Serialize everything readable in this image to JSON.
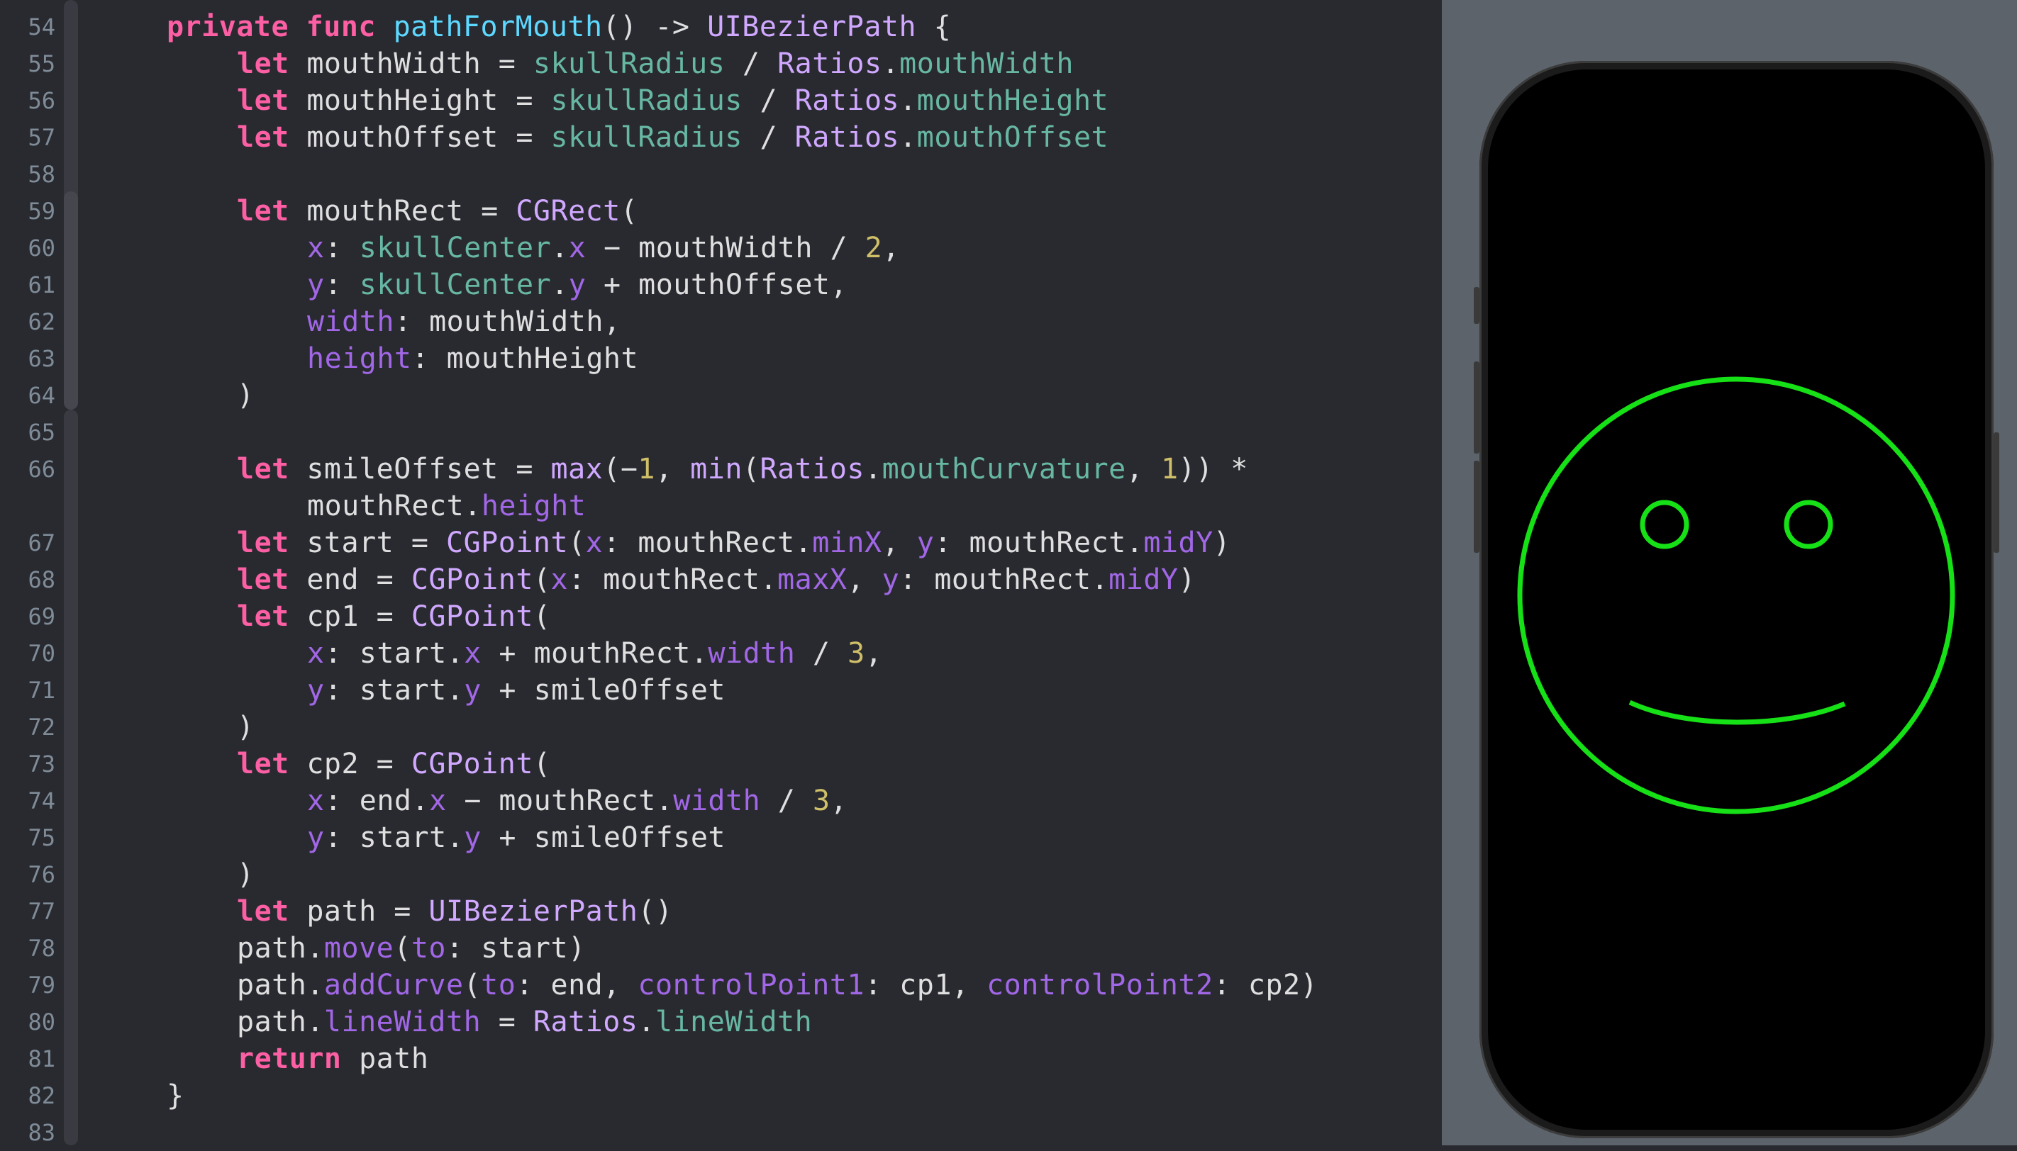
{
  "editor": {
    "lines": [
      {
        "n": "54",
        "indent": 1,
        "tokens": [
          [
            "kw",
            "private"
          ],
          [
            "tx",
            " "
          ],
          [
            "kw",
            "func"
          ],
          [
            "tx",
            " "
          ],
          [
            "cl",
            "pathForMouth"
          ],
          [
            "tx",
            "() -> "
          ],
          [
            "ty",
            "UIBezierPath"
          ],
          [
            "tx",
            " {"
          ]
        ]
      },
      {
        "n": "55",
        "indent": 2,
        "tokens": [
          [
            "kw",
            "let"
          ],
          [
            "tx",
            " mouthWidth = "
          ],
          [
            "fn",
            "skullRadius"
          ],
          [
            "tx",
            " / "
          ],
          [
            "ty",
            "Ratios"
          ],
          [
            "tx",
            "."
          ],
          [
            "fn",
            "mouthWidth"
          ]
        ]
      },
      {
        "n": "56",
        "indent": 2,
        "tokens": [
          [
            "kw",
            "let"
          ],
          [
            "tx",
            " mouthHeight = "
          ],
          [
            "fn",
            "skullRadius"
          ],
          [
            "tx",
            " / "
          ],
          [
            "ty",
            "Ratios"
          ],
          [
            "tx",
            "."
          ],
          [
            "fn",
            "mouthHeight"
          ]
        ]
      },
      {
        "n": "57",
        "indent": 2,
        "tokens": [
          [
            "kw",
            "let"
          ],
          [
            "tx",
            " mouthOffset = "
          ],
          [
            "fn",
            "skullRadius"
          ],
          [
            "tx",
            " / "
          ],
          [
            "ty",
            "Ratios"
          ],
          [
            "tx",
            "."
          ],
          [
            "fn",
            "mouthOffset"
          ]
        ]
      },
      {
        "n": "58",
        "indent": 0,
        "tokens": []
      },
      {
        "n": "59",
        "indent": 2,
        "tokens": [
          [
            "kw",
            "let"
          ],
          [
            "tx",
            " mouthRect = "
          ],
          [
            "ty",
            "CGRect"
          ],
          [
            "tx",
            "("
          ]
        ]
      },
      {
        "n": "60",
        "indent": 3,
        "tokens": [
          [
            "pr",
            "x"
          ],
          [
            "tx",
            ": "
          ],
          [
            "fn",
            "skullCenter"
          ],
          [
            "tx",
            "."
          ],
          [
            "pr",
            "x"
          ],
          [
            "tx",
            " − mouthWidth / "
          ],
          [
            "num",
            "2"
          ],
          [
            "tx",
            ","
          ]
        ]
      },
      {
        "n": "61",
        "indent": 3,
        "tokens": [
          [
            "pr",
            "y"
          ],
          [
            "tx",
            ": "
          ],
          [
            "fn",
            "skullCenter"
          ],
          [
            "tx",
            "."
          ],
          [
            "pr",
            "y"
          ],
          [
            "tx",
            " + mouthOffset,"
          ]
        ]
      },
      {
        "n": "62",
        "indent": 3,
        "tokens": [
          [
            "pr",
            "width"
          ],
          [
            "tx",
            ": mouthWidth,"
          ]
        ]
      },
      {
        "n": "63",
        "indent": 3,
        "tokens": [
          [
            "pr",
            "height"
          ],
          [
            "tx",
            ": mouthHeight"
          ]
        ]
      },
      {
        "n": "64",
        "indent": 2,
        "tokens": [
          [
            "tx",
            ")"
          ]
        ]
      },
      {
        "n": "65",
        "indent": 0,
        "tokens": []
      },
      {
        "n": "66",
        "indent": 2,
        "tokens": [
          [
            "kw",
            "let"
          ],
          [
            "tx",
            " smileOffset = "
          ],
          [
            "ty",
            "max"
          ],
          [
            "tx",
            "(−"
          ],
          [
            "num",
            "1"
          ],
          [
            "tx",
            ", "
          ],
          [
            "ty",
            "min"
          ],
          [
            "tx",
            "("
          ],
          [
            "ty",
            "Ratios"
          ],
          [
            "tx",
            "."
          ],
          [
            "fn",
            "mouthCurvature"
          ],
          [
            "tx",
            ", "
          ],
          [
            "num",
            "1"
          ],
          [
            "tx",
            "))"
          ],
          [
            "tx",
            " *"
          ]
        ]
      },
      {
        "n": "",
        "indent": 3,
        "tokens": [
          [
            "tx",
            "mouthRect."
          ],
          [
            "pr",
            "height"
          ]
        ]
      },
      {
        "n": "67",
        "indent": 2,
        "tokens": [
          [
            "kw",
            "let"
          ],
          [
            "tx",
            " start = "
          ],
          [
            "ty",
            "CGPoint"
          ],
          [
            "tx",
            "("
          ],
          [
            "pr",
            "x"
          ],
          [
            "tx",
            ": mouthRect."
          ],
          [
            "pr",
            "minX"
          ],
          [
            "tx",
            ", "
          ],
          [
            "pr",
            "y"
          ],
          [
            "tx",
            ": mouthRect."
          ],
          [
            "pr",
            "midY"
          ],
          [
            "tx",
            ")"
          ]
        ]
      },
      {
        "n": "68",
        "indent": 2,
        "tokens": [
          [
            "kw",
            "let"
          ],
          [
            "tx",
            " end = "
          ],
          [
            "ty",
            "CGPoint"
          ],
          [
            "tx",
            "("
          ],
          [
            "pr",
            "x"
          ],
          [
            "tx",
            ": mouthRect."
          ],
          [
            "pr",
            "maxX"
          ],
          [
            "tx",
            ", "
          ],
          [
            "pr",
            "y"
          ],
          [
            "tx",
            ": mouthRect."
          ],
          [
            "pr",
            "midY"
          ],
          [
            "tx",
            ")"
          ]
        ]
      },
      {
        "n": "69",
        "indent": 2,
        "tokens": [
          [
            "kw",
            "let"
          ],
          [
            "tx",
            " cp1 = "
          ],
          [
            "ty",
            "CGPoint"
          ],
          [
            "tx",
            "("
          ]
        ]
      },
      {
        "n": "70",
        "indent": 3,
        "tokens": [
          [
            "pr",
            "x"
          ],
          [
            "tx",
            ": start."
          ],
          [
            "pr",
            "x"
          ],
          [
            "tx",
            " + mouthRect."
          ],
          [
            "pr",
            "width"
          ],
          [
            "tx",
            " / "
          ],
          [
            "num",
            "3"
          ],
          [
            "tx",
            ","
          ]
        ]
      },
      {
        "n": "71",
        "indent": 3,
        "tokens": [
          [
            "pr",
            "y"
          ],
          [
            "tx",
            ": start."
          ],
          [
            "pr",
            "y"
          ],
          [
            "tx",
            " + smileOffset"
          ]
        ]
      },
      {
        "n": "72",
        "indent": 2,
        "tokens": [
          [
            "tx",
            ")"
          ]
        ]
      },
      {
        "n": "73",
        "indent": 2,
        "tokens": [
          [
            "kw",
            "let"
          ],
          [
            "tx",
            " cp2 = "
          ],
          [
            "ty",
            "CGPoint"
          ],
          [
            "tx",
            "("
          ]
        ]
      },
      {
        "n": "74",
        "indent": 3,
        "tokens": [
          [
            "pr",
            "x"
          ],
          [
            "tx",
            ": end."
          ],
          [
            "pr",
            "x"
          ],
          [
            "tx",
            " − mouthRect."
          ],
          [
            "pr",
            "width"
          ],
          [
            "tx",
            " / "
          ],
          [
            "num",
            "3"
          ],
          [
            "tx",
            ","
          ]
        ]
      },
      {
        "n": "75",
        "indent": 3,
        "tokens": [
          [
            "pr",
            "y"
          ],
          [
            "tx",
            ": start."
          ],
          [
            "pr",
            "y"
          ],
          [
            "tx",
            " + smileOffset"
          ]
        ]
      },
      {
        "n": "76",
        "indent": 2,
        "tokens": [
          [
            "tx",
            ")"
          ]
        ]
      },
      {
        "n": "77",
        "indent": 2,
        "tokens": [
          [
            "kw",
            "let"
          ],
          [
            "tx",
            " path = "
          ],
          [
            "ty",
            "UIBezierPath"
          ],
          [
            "tx",
            "()"
          ]
        ]
      },
      {
        "n": "78",
        "indent": 2,
        "tokens": [
          [
            "tx",
            "path."
          ],
          [
            "pr",
            "move"
          ],
          [
            "tx",
            "("
          ],
          [
            "pr",
            "to"
          ],
          [
            "tx",
            ": start)"
          ]
        ]
      },
      {
        "n": "79",
        "indent": 2,
        "tokens": [
          [
            "tx",
            "path."
          ],
          [
            "pr",
            "addCurve"
          ],
          [
            "tx",
            "("
          ],
          [
            "pr",
            "to"
          ],
          [
            "tx",
            ": end, "
          ],
          [
            "pr",
            "controlPoint1"
          ],
          [
            "tx",
            ": cp1, "
          ],
          [
            "pr",
            "controlPoint2"
          ],
          [
            "tx",
            ": cp2)"
          ]
        ]
      },
      {
        "n": "80",
        "indent": 2,
        "tokens": [
          [
            "tx",
            "path."
          ],
          [
            "pr",
            "lineWidth"
          ],
          [
            "tx",
            " = "
          ],
          [
            "ty",
            "Ratios"
          ],
          [
            "tx",
            "."
          ],
          [
            "fn",
            "lineWidth"
          ]
        ]
      },
      {
        "n": "81",
        "indent": 2,
        "tokens": [
          [
            "kw",
            "return"
          ],
          [
            "tx",
            " path"
          ]
        ]
      },
      {
        "n": "82",
        "indent": 1,
        "tokens": [
          [
            "tx",
            "}"
          ]
        ]
      },
      {
        "n": "83",
        "indent": 0,
        "tokens": []
      }
    ]
  },
  "preview": {
    "device": "iPhone",
    "face_color": "#16e016"
  }
}
